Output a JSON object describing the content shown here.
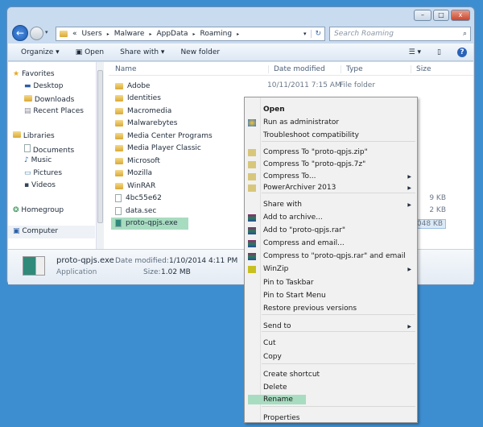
{
  "window": {
    "minimize": "–",
    "maximize": "□",
    "close": "x"
  },
  "address": {
    "breadcrumb": [
      "«",
      "Users",
      "Malware",
      "AppData",
      "Roaming"
    ],
    "search_placeholder": "Search Roaming"
  },
  "toolbar": {
    "organize": "Organize ▾",
    "open": "Open",
    "share_with": "Share with ▾",
    "new_folder": "New folder"
  },
  "sidebar": {
    "favorites": "Favorites",
    "desktop": "Desktop",
    "downloads": "Downloads",
    "recent": "Recent Places",
    "libraries": "Libraries",
    "documents": "Documents",
    "music": "Music",
    "pictures": "Pictures",
    "videos": "Videos",
    "homegroup": "Homegroup",
    "computer": "Computer"
  },
  "columns": {
    "name": "Name",
    "date": "Date modified",
    "type": "Type",
    "size": "Size"
  },
  "files": [
    {
      "name": "Adobe",
      "date": "10/11/2011 7:15 AM",
      "type": "File folder",
      "size": "",
      "kind": "folder"
    },
    {
      "name": "Identities",
      "date": "",
      "type": "",
      "size": "",
      "kind": "folder"
    },
    {
      "name": "Macromedia",
      "date": "",
      "type": "",
      "size": "",
      "kind": "folder"
    },
    {
      "name": "Malwarebytes",
      "date": "",
      "type": "",
      "size": "",
      "kind": "folder"
    },
    {
      "name": "Media Center Programs",
      "date": "",
      "type": "",
      "size": "",
      "kind": "folder"
    },
    {
      "name": "Media Player Classic",
      "date": "",
      "type": "",
      "size": "",
      "kind": "folder"
    },
    {
      "name": "Microsoft",
      "date": "",
      "type": "",
      "size": "",
      "kind": "folder"
    },
    {
      "name": "Mozilla",
      "date": "",
      "type": "",
      "size": "",
      "kind": "folder"
    },
    {
      "name": "WinRAR",
      "date": "",
      "type": "",
      "size": "",
      "kind": "folder"
    },
    {
      "name": "4bc55e62",
      "date": "",
      "type": "",
      "size": "9 KB",
      "kind": "file"
    },
    {
      "name": "data.sec",
      "date": "",
      "type": "",
      "size": "2 KB",
      "kind": "file"
    },
    {
      "name": "proto-qpjs.exe",
      "date": "",
      "type": "",
      "size": "1,048 KB",
      "kind": "exe"
    }
  ],
  "status": {
    "name": "proto-qpjs.exe",
    "date_label": "Date modified:",
    "date": "1/10/2014 4:11 PM",
    "type": "Application",
    "size_label": "Size:",
    "size": "1.02 MB"
  },
  "menu": [
    "Open",
    "Run as administrator",
    "Troubleshoot compatibility",
    "Compress To \"proto-qpjs.zip\"",
    "Compress To \"proto-qpjs.7z\"",
    "Compress To...",
    "PowerArchiver 2013",
    "Share with",
    "Add to archive...",
    "Add to \"proto-qpjs.rar\"",
    "Compress and email...",
    "Compress to \"proto-qpjs.rar\" and email",
    "WinZip",
    "Pin to Taskbar",
    "Pin to Start Menu",
    "Restore previous versions",
    "Send to",
    "Cut",
    "Copy",
    "Create shortcut",
    "Delete",
    "Rename",
    "Properties"
  ],
  "colors": {
    "desktop": "#3d8ed0",
    "highlight": "#a8dcc0"
  }
}
